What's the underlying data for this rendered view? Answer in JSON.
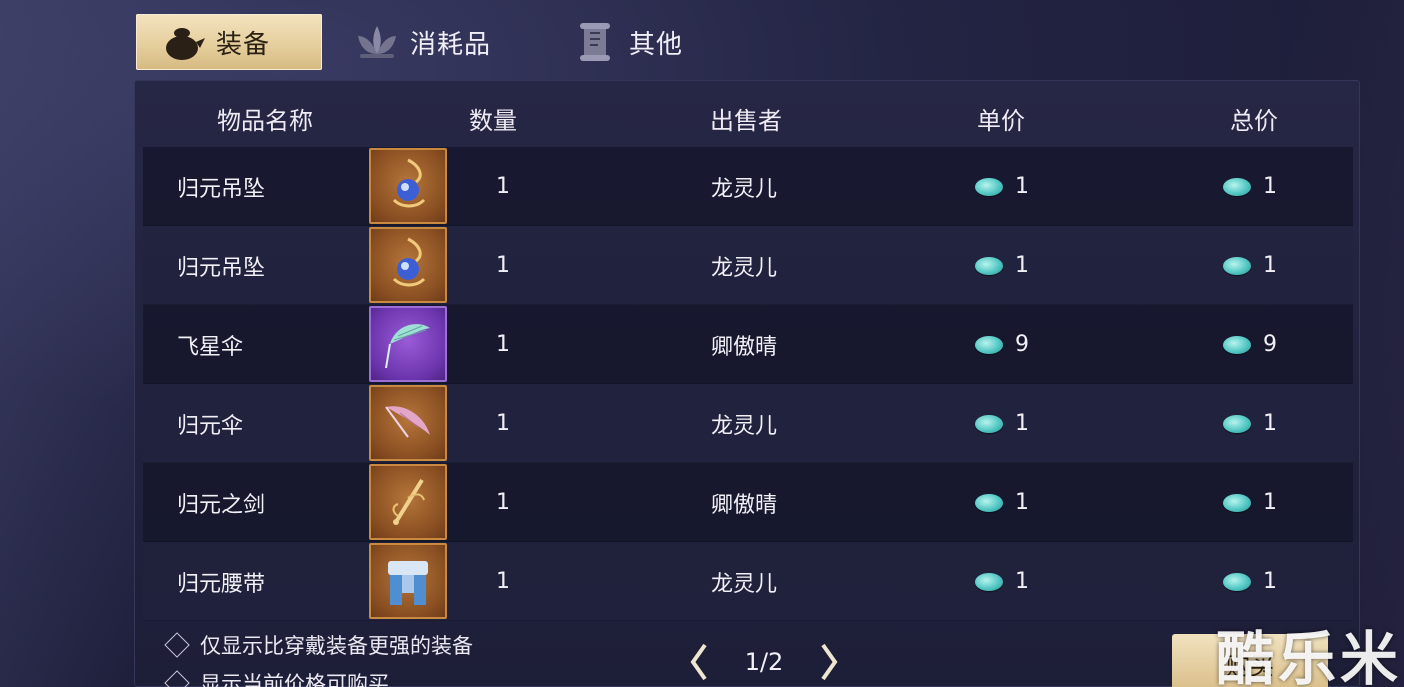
{
  "tabs": [
    {
      "label": "装备",
      "icon": "bag-icon"
    },
    {
      "label": "消耗品",
      "icon": "lotus-icon"
    },
    {
      "label": "其他",
      "icon": "scroll-icon"
    }
  ],
  "table": {
    "headers": {
      "name": "物品名称",
      "qty": "数量",
      "seller": "出售者",
      "unit": "单价",
      "total": "总价"
    },
    "rows": [
      {
        "name": "归元吊坠",
        "qty": "1",
        "seller": "龙灵儿",
        "unit": "1",
        "total": "1",
        "thumb": "pendant-icon"
      },
      {
        "name": "归元吊坠",
        "qty": "1",
        "seller": "龙灵儿",
        "unit": "1",
        "total": "1",
        "thumb": "pendant-icon"
      },
      {
        "name": "飞星伞",
        "qty": "1",
        "seller": "卿傲晴",
        "unit": "9",
        "total": "9",
        "thumb": "umbrella-icon"
      },
      {
        "name": "归元伞",
        "qty": "1",
        "seller": "龙灵儿",
        "unit": "1",
        "total": "1",
        "thumb": "umbrella-icon"
      },
      {
        "name": "归元之剑",
        "qty": "1",
        "seller": "卿傲晴",
        "unit": "1",
        "total": "1",
        "thumb": "sword-icon"
      },
      {
        "name": "归元腰带",
        "qty": "1",
        "seller": "龙灵儿",
        "unit": "1",
        "total": "1",
        "thumb": "belt-icon"
      }
    ]
  },
  "filters": {
    "stronger_only": "仅显示比穿戴装备更强的装备",
    "affordable_only": "显示当前价格可购买"
  },
  "pager": {
    "label": "1/2"
  },
  "buy_label": "购买",
  "watermark": "酷乐米"
}
